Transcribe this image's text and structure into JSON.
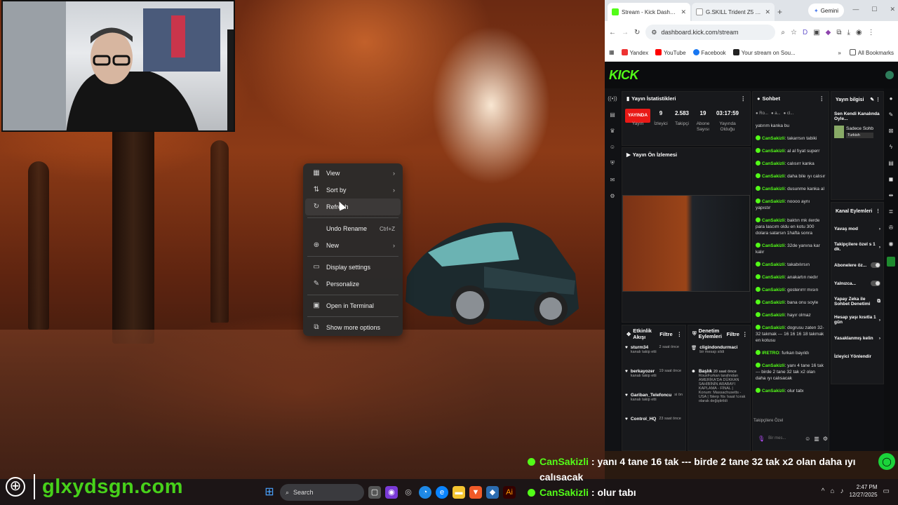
{
  "context_menu": {
    "items": [
      {
        "label": "View",
        "icon": "grid-icon",
        "submenu": true
      },
      {
        "label": "Sort by",
        "icon": "sort-icon",
        "submenu": true
      },
      {
        "label": "Refresh",
        "icon": "refresh-icon"
      },
      {
        "label": "Undo Rename",
        "icon": "undo-icon",
        "shortcut": "Ctrl+Z"
      },
      {
        "label": "New",
        "icon": "new-icon",
        "submenu": true
      },
      {
        "label": "Display settings",
        "icon": "display-icon"
      },
      {
        "label": "Personalize",
        "icon": "brush-icon"
      },
      {
        "label": "Open in Terminal",
        "icon": "terminal-icon"
      },
      {
        "label": "Show more options",
        "icon": "more-options-icon"
      }
    ]
  },
  "overlay": {
    "brand": "glxydsgn.com",
    "chat": [
      {
        "user": "CanSakizli",
        "message": ": yanı 4 tane 16 tak --- birde 2 tane 32 tak x2 olan daha ıyı calısacak"
      },
      {
        "user": "CanSakizli",
        "message": ": olur tabı"
      }
    ]
  },
  "taskbar": {
    "search": "Search",
    "time": "2:47 PM",
    "date": "12/27/2025"
  },
  "browser": {
    "tabs": [
      {
        "title": "Stream - Kick Dashboard",
        "active": true
      },
      {
        "title": "G.SKILL Trident Z5 Neo RG...",
        "active": false
      }
    ],
    "gemini": "Gemini",
    "url": "dashboard.kick.com/stream",
    "bookmarks": [
      "Yandex",
      "YouTube",
      "Facebook",
      "Your stream on Sou...",
      "All Bookmarks"
    ],
    "kick": {
      "logo": "KICK",
      "stats_title": "Yayın İstatistikleri",
      "live_badge": "YAYINDA",
      "stats": [
        {
          "value": "",
          "label": "Yayın"
        },
        {
          "value": "9",
          "label": "İzleyici"
        },
        {
          "value": "2.583",
          "label": "Takipçi"
        },
        {
          "value": "19",
          "label": "Abone Sayısı"
        },
        {
          "value": "03:17:59",
          "label": "Yayında Olduğu"
        }
      ],
      "preview_title": "Yayın Ön İzlemesi",
      "chat_title": "Sohbet",
      "chat_first": "yatırım kanka bu",
      "chat": [
        {
          "u": "CanSakizli",
          "m": "takarrsın tabiki"
        },
        {
          "u": "CanSakizli",
          "m": "al al fıyat superr"
        },
        {
          "u": "CanSakizli",
          "m": "calısırr kanka"
        },
        {
          "u": "CanSakizli",
          "m": "daha bile ıyı calısır"
        },
        {
          "u": "CanSakizli",
          "m": "dusunme kanka al"
        },
        {
          "u": "CanSakizli",
          "m": "noooo aynı yapıstır"
        },
        {
          "u": "CanSakizli",
          "m": "baktın mk ılerde para lascım oldu en kotu 300 dolara satarsın 1hafta sonra"
        },
        {
          "u": "CanSakizli",
          "m": "32de yanına kar kalır"
        },
        {
          "u": "CanSakizli",
          "m": "takabılırsın"
        },
        {
          "u": "CanSakizli",
          "m": "anakartın nedır"
        },
        {
          "u": "CanSakizli",
          "m": "gosterırrr mısın"
        },
        {
          "u": "CanSakizli",
          "m": "bana onu soyle"
        },
        {
          "u": "CanSakizli",
          "m": "hayır olmaz"
        },
        {
          "u": "CanSakizli",
          "m": "dogrusu zaten 32-32 takmak --- 16 16 16 18 takmak en kotusu"
        },
        {
          "u": "IRETRO",
          "m": "furkan bayıldı"
        },
        {
          "u": "CanSakizli",
          "m": "yanı 4 tane 16 tak --- birde 2 tane 32 tak x2 olan daha ıyı calısacak"
        },
        {
          "u": "CanSakizli",
          "m": "olur tabı"
        }
      ],
      "info_title": "Yayın bilgisi",
      "info_text": "Sen Kendi Kanalında Oyle...",
      "info_cat": "Sadece Sohb",
      "info_lang": "Turkish",
      "channel_actions_title": "Kanal Eylemleri",
      "channel_actions": [
        "Yavaş mod",
        "Takipçilere özel s 1 dk.",
        "Abonelere öz...",
        "Yalnızca...",
        "Yapay Zeka ile Sohbet Denetimi",
        "Hesap yaşı kısıtla 1 gün",
        "Yasaklanmış kelin",
        "İzleyici Yönlendir"
      ],
      "activity_title": "Etkinlik Akışı",
      "filter": "Filtre",
      "activity": [
        {
          "name": "sturm34",
          "time": "2 saat önce",
          "sub": "kanalı takip etti"
        },
        {
          "name": "berkayozer",
          "time": "19 saat önce",
          "sub": "kanalı takip etti"
        },
        {
          "name": "Gariban_Telefoncu",
          "time": "si ön",
          "sub": "kanalı takip etti"
        },
        {
          "name": "Control_HQ",
          "time": "23 saat önce",
          "sub": ""
        }
      ],
      "mod_title": "Denetim Eylemleri",
      "mod": [
        {
          "name": "cligindondurmaci",
          "sub": "bir mesajı sildi"
        },
        {
          "name": "Başlık",
          "time": "20 saat önce",
          "sub": "RouxFurkan tarafından AMERİKA'DA DÜKKAN SAHİBİNİN ARABAYI KAPLAMA - FİNAL | Konum: Massachusetts - USA | !blerp !tts !saat !cırak olarak değiştirildi"
        }
      ],
      "followers_only": "Takipçilere Özel"
    }
  }
}
